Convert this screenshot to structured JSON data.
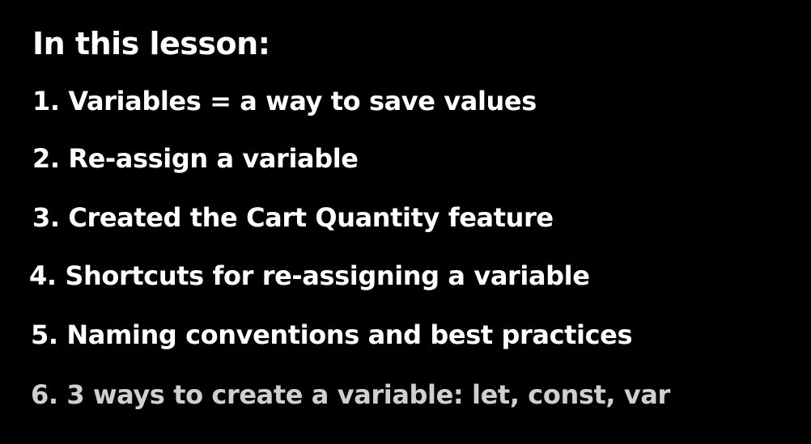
{
  "lesson": {
    "heading": "In this lesson:",
    "items": [
      "1. Variables = a way to save values",
      "2. Re-assign a variable",
      "3. Created the Cart Quantity feature",
      "4. Shortcuts for re-assigning a variable",
      "5. Naming conventions and best practices",
      "6. 3 ways to create a variable: let, const, var"
    ]
  },
  "colors": {
    "background": "#000000",
    "text": "#ffffff",
    "last_item_text": "#cfcfcf"
  }
}
